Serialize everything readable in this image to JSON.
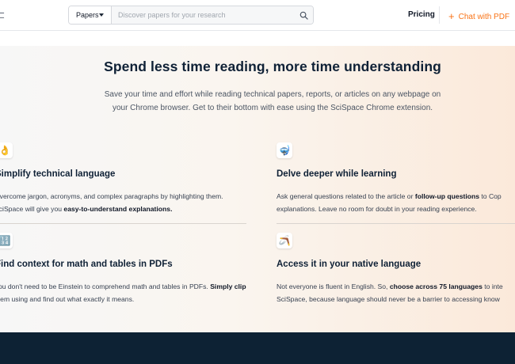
{
  "header": {
    "search": {
      "select_label": "Papers",
      "placeholder": "Discover papers for your research"
    },
    "nav": {
      "pricing_label": "Pricing",
      "chat_plus": "+",
      "chat_label": "Chat with PDF"
    }
  },
  "hero": {
    "title": "Spend less time reading, more time understanding",
    "subtitle_line1": "Save your time and effort while reading technical papers, reports, or articles on any webpage on",
    "subtitle_line2": "your Chrome browser. Get to their bottom with ease using the SciSpace Chrome extension."
  },
  "features": [
    {
      "icon": "hand-icon",
      "glyph": "👌",
      "title": "Simplify technical language",
      "line1": "Overcome jargon, acronyms, and complex paragraphs by highlighting them.",
      "line2_pre": "SciSpace will give you ",
      "line2_bold": "easy-to-understand explanations.",
      "line2_post": ""
    },
    {
      "icon": "diving-mask-icon",
      "glyph": "🤿",
      "title": "Delve deeper while learning",
      "line1_pre": "Ask general questions related to the article or ",
      "line1_bold": "follow-up questions",
      "line1_post": " to Cop",
      "line2": "explanations. Leave no room for doubt in your reading experience."
    },
    {
      "icon": "numbers-icon",
      "glyph": "🔢",
      "title": "Find context for math and tables in PDFs",
      "line1_pre": "You don't need to be Einstein to comprehend math and tables in PDFs. ",
      "line1_bold": "Simply clip",
      "line2": "them using and find out what exactly it means."
    },
    {
      "icon": "boomerang-icon",
      "glyph": "🪃",
      "title": "Access it in your native language",
      "line1_pre": "Not everyone is fluent in English. So, ",
      "line1_bold": "choose across 75 languages",
      "line1_post": " to inte",
      "line2": "SciSpace, because language should never be a barrier to accessing know"
    }
  ],
  "colors": {
    "accent": "#f97316",
    "heading": "#0f2136",
    "footer_band": "#0d2234"
  }
}
